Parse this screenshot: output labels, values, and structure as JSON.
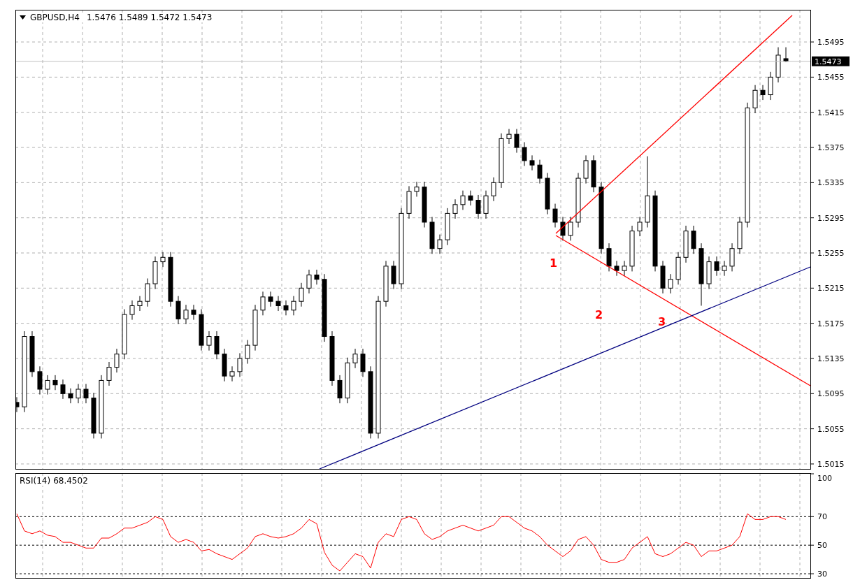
{
  "price_chart": {
    "symbol": "GBPUSD,H4",
    "quote": "1.5476 1.5489 1.5472 1.5473",
    "chart_data": {
      "type": "candlestick",
      "grid": true,
      "ylim": [
        1.50086,
        1.55316
      ],
      "yticks": [
        {
          "value": 1.5495,
          "label": "1.5495"
        },
        {
          "value": 1.5455,
          "label": "1.5455"
        },
        {
          "value": 1.5415,
          "label": "1.5415"
        },
        {
          "value": 1.5375,
          "label": "1.5375"
        },
        {
          "value": 1.5335,
          "label": "1.5335"
        },
        {
          "value": 1.5295,
          "label": "1.5295"
        },
        {
          "value": 1.5255,
          "label": "1.5255"
        },
        {
          "value": 1.5215,
          "label": "1.5215"
        },
        {
          "value": 1.5175,
          "label": "1.5175"
        },
        {
          "value": 1.5135,
          "label": "1.5135"
        },
        {
          "value": 1.5095,
          "label": "1.5095"
        },
        {
          "value": 1.5055,
          "label": "1.5055"
        },
        {
          "value": 1.5015,
          "label": "1.5015"
        }
      ],
      "ohlc": [
        [
          1.5085,
          1.5091,
          1.5074,
          1.508
        ],
        [
          1.508,
          1.5166,
          1.5074,
          1.516
        ],
        [
          1.516,
          1.5166,
          1.5114,
          1.512
        ],
        [
          1.512,
          1.5126,
          1.5094,
          1.51
        ],
        [
          1.51,
          1.5116,
          1.5094,
          1.511
        ],
        [
          1.511,
          1.5116,
          1.5099,
          1.5105
        ],
        [
          1.5105,
          1.5111,
          1.5089,
          1.5095
        ],
        [
          1.5095,
          1.5101,
          1.5084,
          1.509
        ],
        [
          1.509,
          1.5106,
          1.5084,
          1.51
        ],
        [
          1.51,
          1.5106,
          1.5084,
          1.509
        ],
        [
          1.509,
          1.5096,
          1.5044,
          1.505
        ],
        [
          1.505,
          1.5116,
          1.5044,
          1.511
        ],
        [
          1.511,
          1.5131,
          1.5104,
          1.5125
        ],
        [
          1.5125,
          1.5146,
          1.5119,
          1.514
        ],
        [
          1.514,
          1.5191,
          1.5134,
          1.5185
        ],
        [
          1.5185,
          1.5201,
          1.5179,
          1.5195
        ],
        [
          1.5195,
          1.5206,
          1.5189,
          1.52
        ],
        [
          1.52,
          1.5226,
          1.5194,
          1.522
        ],
        [
          1.522,
          1.5251,
          1.5214,
          1.5245
        ],
        [
          1.5245,
          1.5256,
          1.5239,
          1.525
        ],
        [
          1.525,
          1.5256,
          1.5194,
          1.52
        ],
        [
          1.52,
          1.5206,
          1.5174,
          1.518
        ],
        [
          1.518,
          1.5196,
          1.5174,
          1.519
        ],
        [
          1.519,
          1.5196,
          1.5179,
          1.5185
        ],
        [
          1.5185,
          1.5191,
          1.5144,
          1.515
        ],
        [
          1.515,
          1.5166,
          1.5144,
          1.516
        ],
        [
          1.516,
          1.5166,
          1.5134,
          1.514
        ],
        [
          1.514,
          1.5146,
          1.5109,
          1.5115
        ],
        [
          1.5115,
          1.5126,
          1.5109,
          1.512
        ],
        [
          1.512,
          1.5141,
          1.5114,
          1.5135
        ],
        [
          1.5135,
          1.5156,
          1.5129,
          1.515
        ],
        [
          1.515,
          1.5196,
          1.5144,
          1.519
        ],
        [
          1.519,
          1.5211,
          1.5184,
          1.5205
        ],
        [
          1.5205,
          1.5211,
          1.5194,
          1.52
        ],
        [
          1.52,
          1.5206,
          1.5189,
          1.5195
        ],
        [
          1.5195,
          1.5201,
          1.5184,
          1.519
        ],
        [
          1.519,
          1.5206,
          1.5184,
          1.52
        ],
        [
          1.52,
          1.5221,
          1.5194,
          1.5215
        ],
        [
          1.5215,
          1.5236,
          1.5209,
          1.523
        ],
        [
          1.523,
          1.5236,
          1.5219,
          1.5225
        ],
        [
          1.5225,
          1.5231,
          1.5154,
          1.516
        ],
        [
          1.516,
          1.5166,
          1.5104,
          1.511
        ],
        [
          1.511,
          1.5116,
          1.5084,
          1.509
        ],
        [
          1.509,
          1.5136,
          1.5084,
          1.513
        ],
        [
          1.513,
          1.5146,
          1.5124,
          1.514
        ],
        [
          1.514,
          1.5146,
          1.5114,
          1.512
        ],
        [
          1.512,
          1.5126,
          1.5044,
          1.505
        ],
        [
          1.505,
          1.5206,
          1.5044,
          1.52
        ],
        [
          1.52,
          1.5246,
          1.5194,
          1.524
        ],
        [
          1.524,
          1.5246,
          1.5214,
          1.522
        ],
        [
          1.522,
          1.5306,
          1.5214,
          1.53
        ],
        [
          1.53,
          1.5331,
          1.5294,
          1.5325
        ],
        [
          1.5325,
          1.5336,
          1.5319,
          1.533
        ],
        [
          1.533,
          1.5336,
          1.5284,
          1.529
        ],
        [
          1.529,
          1.5296,
          1.5254,
          1.526
        ],
        [
          1.526,
          1.5276,
          1.5254,
          1.527
        ],
        [
          1.527,
          1.5306,
          1.5264,
          1.53
        ],
        [
          1.53,
          1.5316,
          1.5294,
          1.531
        ],
        [
          1.531,
          1.5326,
          1.5304,
          1.532
        ],
        [
          1.532,
          1.5326,
          1.5309,
          1.5315
        ],
        [
          1.5315,
          1.5321,
          1.5294,
          1.53
        ],
        [
          1.53,
          1.5326,
          1.5294,
          1.532
        ],
        [
          1.532,
          1.5341,
          1.5314,
          1.5335
        ],
        [
          1.5335,
          1.5391,
          1.5329,
          1.5385
        ],
        [
          1.5385,
          1.5396,
          1.5379,
          1.539
        ],
        [
          1.539,
          1.5396,
          1.5369,
          1.5375
        ],
        [
          1.5375,
          1.5381,
          1.5354,
          1.536
        ],
        [
          1.536,
          1.5366,
          1.5349,
          1.5355
        ],
        [
          1.5355,
          1.5361,
          1.5334,
          1.534
        ],
        [
          1.534,
          1.5346,
          1.5299,
          1.5305
        ],
        [
          1.5305,
          1.5311,
          1.5284,
          1.529
        ],
        [
          1.529,
          1.5296,
          1.5269,
          1.5275
        ],
        [
          1.5275,
          1.5296,
          1.5269,
          1.529
        ],
        [
          1.529,
          1.5346,
          1.5284,
          1.534
        ],
        [
          1.534,
          1.5366,
          1.5334,
          1.536
        ],
        [
          1.536,
          1.5366,
          1.5324,
          1.533
        ],
        [
          1.533,
          1.5336,
          1.5254,
          1.526
        ],
        [
          1.526,
          1.5266,
          1.5234,
          1.524
        ],
        [
          1.524,
          1.5246,
          1.5229,
          1.5235
        ],
        [
          1.5235,
          1.5246,
          1.5229,
          1.524
        ],
        [
          1.524,
          1.5286,
          1.5234,
          1.528
        ],
        [
          1.528,
          1.5296,
          1.5274,
          1.529
        ],
        [
          1.529,
          1.5365,
          1.5284,
          1.532
        ],
        [
          1.532,
          1.5326,
          1.5234,
          1.524
        ],
        [
          1.524,
          1.5246,
          1.5209,
          1.5215
        ],
        [
          1.5215,
          1.5231,
          1.5209,
          1.5225
        ],
        [
          1.5225,
          1.5256,
          1.5219,
          1.525
        ],
        [
          1.525,
          1.5286,
          1.5244,
          1.528
        ],
        [
          1.528,
          1.5286,
          1.5254,
          1.526
        ],
        [
          1.526,
          1.5266,
          1.5195,
          1.522
        ],
        [
          1.522,
          1.5251,
          1.5214,
          1.5245
        ],
        [
          1.5245,
          1.5251,
          1.5229,
          1.5235
        ],
        [
          1.5235,
          1.5246,
          1.5229,
          1.524
        ],
        [
          1.524,
          1.5266,
          1.5234,
          1.526
        ],
        [
          1.526,
          1.5296,
          1.5254,
          1.529
        ],
        [
          1.529,
          1.5426,
          1.5284,
          1.542
        ],
        [
          1.542,
          1.5446,
          1.5414,
          1.544
        ],
        [
          1.544,
          1.5446,
          1.5429,
          1.5435
        ],
        [
          1.5435,
          1.5461,
          1.5429,
          1.5455
        ],
        [
          1.5455,
          1.5489,
          1.5449,
          1.548
        ],
        [
          1.5476,
          1.5489,
          1.5472,
          1.5473
        ],
        null,
        null,
        null
      ],
      "annotations": [
        "1",
        "2",
        "3"
      ]
    },
    "current_price": "1.5473"
  },
  "rsi_chart": {
    "value": "68.4502",
    "chart_data": {
      "type": "line",
      "grid": true,
      "ylim": [
        26.6,
        100.5
      ],
      "yticks": [
        {
          "value": 100,
          "label": "100"
        },
        {
          "value": 70,
          "label": "70"
        },
        {
          "value": 50,
          "label": "50"
        },
        {
          "value": 30,
          "label": "30"
        }
      ],
      "series": [
        {
          "name": "RSI(14)",
          "color": "#ff0000",
          "values": [
            72,
            60,
            58,
            60,
            57,
            56,
            52,
            52,
            50,
            48,
            48,
            55,
            55,
            58,
            62,
            62,
            64,
            66,
            70,
            68,
            56,
            52,
            54,
            52,
            46,
            47,
            44,
            42,
            40,
            44,
            48,
            56,
            58,
            56,
            55,
            56,
            58,
            62,
            68,
            65,
            45,
            36,
            32,
            38,
            44,
            42,
            34,
            52,
            58,
            56,
            68,
            70,
            68,
            58,
            54,
            56,
            60,
            62,
            64,
            62,
            60,
            62,
            64,
            70,
            70,
            66,
            62,
            60,
            56,
            50,
            46,
            42,
            46,
            54,
            56,
            50,
            40,
            38,
            38,
            40,
            48,
            52,
            56,
            44,
            42,
            44,
            48,
            52,
            50,
            42,
            46,
            46,
            48,
            50,
            56,
            72,
            68,
            68,
            70,
            70,
            68,
            null,
            null,
            null
          ]
        }
      ]
    }
  }
}
